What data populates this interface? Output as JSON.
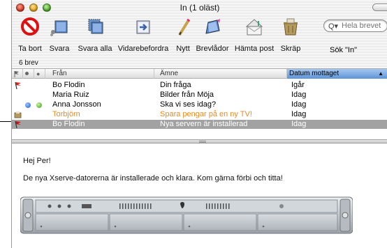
{
  "window": {
    "title": "In (1 oläst)"
  },
  "toolbar": {
    "buttons": [
      {
        "label": "Ta bort",
        "icon": "delete-icon"
      },
      {
        "label": "Svara",
        "icon": "reply-icon"
      },
      {
        "label": "Svara alla",
        "icon": "reply-all-icon"
      },
      {
        "label": "Vidarebefordra",
        "icon": "forward-icon"
      },
      {
        "label": "Nytt",
        "icon": "compose-icon"
      },
      {
        "label": "Brevlådor",
        "icon": "mailboxes-icon"
      },
      {
        "label": "Hämta post",
        "icon": "get-mail-icon"
      },
      {
        "label": "Skräp",
        "icon": "junk-icon"
      }
    ],
    "search": {
      "placeholder": "Hela brevet",
      "label": "Sök \"In\""
    }
  },
  "message_count": "6 brev",
  "table": {
    "columns": {
      "from": "Från",
      "subject": "Ämne",
      "date": "Datum mottaget"
    },
    "sort_arrow": "▲",
    "rows": [
      {
        "from": "Bo Flodin",
        "subject": "Din fråga",
        "date": "Igår",
        "flag": "red"
      },
      {
        "from": "Maria Ruiz",
        "subject": "Bilder från Möja",
        "date": "Idag"
      },
      {
        "from": "Anna Jonsson",
        "subject": "Ska vi ses idag?",
        "date": "Idag",
        "status": [
          "blue-dot",
          "green-dot"
        ]
      },
      {
        "from": "Torbjörn",
        "subject": "Spara pengar på en ny TV!",
        "date": "Idag",
        "junk": true,
        "color": "#ee8a1a"
      },
      {
        "from": "Bo Flodin",
        "subject": "Nya servern är installerad",
        "date": "Idag",
        "flag": "red",
        "selected": true
      }
    ]
  },
  "preview": {
    "greeting": "Hej Per!",
    "body": "De nya Xserve-datorerna är installerade och klara. Kom gärna förbi och titta!"
  },
  "colors": {
    "selection": "#a2a2a2",
    "sort_header": "#7fb0e6",
    "junk_text": "#ee8a1a"
  }
}
